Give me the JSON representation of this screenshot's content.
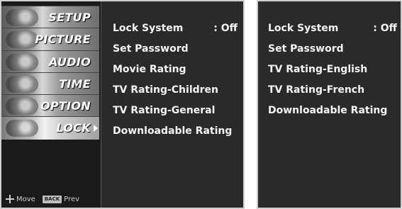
{
  "left_screen": {
    "nav_tabs": [
      {
        "label": "SETUP",
        "icon": "satellite-dish-icon"
      },
      {
        "label": "PICTURE",
        "icon": "picture-icon"
      },
      {
        "label": "AUDIO",
        "icon": "speaker-icon"
      },
      {
        "label": "TIME",
        "icon": "clock-icon"
      },
      {
        "label": "OPTION",
        "icon": "option-icon"
      },
      {
        "label": "LOCK",
        "icon": "lock-icon"
      }
    ],
    "selected_tab": "LOCK",
    "hints": {
      "move_label": "Move",
      "back_key": "BACK",
      "prev_label": "Prev"
    },
    "menu_items": [
      {
        "label": "Lock System",
        "value": ": Off"
      },
      {
        "label": "Set Password"
      },
      {
        "label": "Movie Rating"
      },
      {
        "label": "TV Rating-Children"
      },
      {
        "label": "TV Rating-General"
      },
      {
        "label": "Downloadable Rating"
      }
    ]
  },
  "right_screen": {
    "menu_items": [
      {
        "label": "Lock System",
        "value": ": Off"
      },
      {
        "label": "Set Password"
      },
      {
        "label": "TV Rating-English"
      },
      {
        "label": "TV Rating-French"
      },
      {
        "label": "Downloadable Rating"
      }
    ]
  },
  "colors": {
    "panel_background": "#2a2a2a",
    "strip_background": "#1a1a1a",
    "text": "#f4f4f4",
    "page_background": "#ffffff"
  }
}
